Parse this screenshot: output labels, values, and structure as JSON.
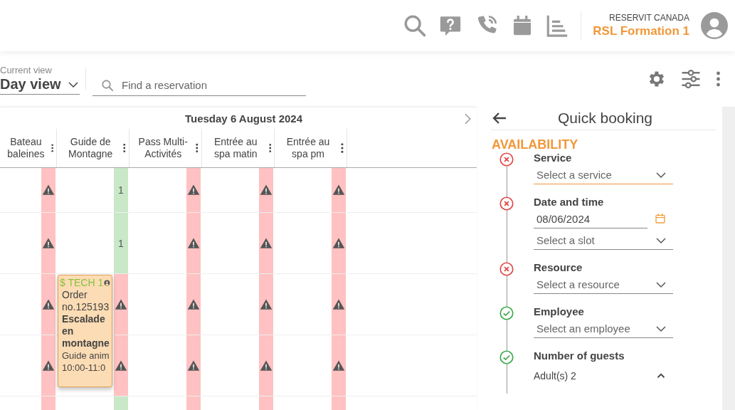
{
  "header": {
    "company": "RESERVIT CANADA",
    "account": "RSL Formation 1"
  },
  "toolbar": {
    "view_label": "Current view",
    "view": "Day view",
    "search": {
      "placeholder": "Find a reservation"
    }
  },
  "calendar": {
    "date": "Tuesday 6 August 2024",
    "columns": [
      {
        "name": "Bateau baleines",
        "slots": [
          {
            "kind": "full",
            "warning": true
          },
          {
            "kind": "full",
            "warning": true
          },
          {
            "kind": "full",
            "warning": true
          },
          {
            "kind": "full",
            "warning": true
          },
          {
            "kind": "full",
            "warning": false
          }
        ]
      },
      {
        "name": "Guide de Montagne",
        "slots": [
          {
            "kind": "available",
            "count": "1"
          },
          {
            "kind": "available",
            "count": "1"
          },
          {
            "kind": "full",
            "warning": true,
            "booking": {
              "tag": "$ TECH 1",
              "order": "Order no.125193",
              "service": "Escalade en montagne",
              "staff": "Guide anim",
              "time": "10:00-11:0"
            }
          },
          {
            "kind": "full",
            "warning": true
          },
          {
            "kind": "available"
          }
        ]
      },
      {
        "name": "Pass Multi-Activités",
        "slots": [
          {
            "kind": "full",
            "warning": true
          },
          {
            "kind": "full",
            "warning": true
          },
          {
            "kind": "full",
            "warning": true
          },
          {
            "kind": "full",
            "warning": true
          },
          {
            "kind": "full",
            "warning": false
          }
        ]
      },
      {
        "name": "Entrée au spa matin",
        "slots": [
          {
            "kind": "full",
            "warning": true
          },
          {
            "kind": "full",
            "warning": true
          },
          {
            "kind": "full",
            "warning": true
          },
          {
            "kind": "full",
            "warning": true
          },
          {
            "kind": "full",
            "warning": false
          }
        ]
      },
      {
        "name": "Entrée au spa pm",
        "slots": [
          {
            "kind": "full",
            "warning": true
          },
          {
            "kind": "full",
            "warning": true
          },
          {
            "kind": "full",
            "warning": true
          },
          {
            "kind": "full",
            "warning": true
          },
          {
            "kind": "full",
            "warning": false
          }
        ]
      }
    ]
  },
  "booking": {
    "title": "Quick booking",
    "section": "AVAILABILITY",
    "steps": [
      {
        "label": "Service",
        "complete": false,
        "fields": [
          {
            "kind": "select",
            "placeholder": "Select a service",
            "focused": true
          }
        ]
      },
      {
        "label": "Date and time",
        "complete": false,
        "fields": [
          {
            "kind": "date",
            "value": "08/06/2024"
          },
          {
            "kind": "select",
            "placeholder": "Select a slot",
            "focused": false
          }
        ]
      },
      {
        "label": "Resource",
        "complete": false,
        "fields": [
          {
            "kind": "select",
            "placeholder": "Select a resource",
            "focused": false
          }
        ]
      },
      {
        "label": "Employee",
        "complete": true,
        "fields": [
          {
            "kind": "select",
            "placeholder": "Select an employee",
            "focused": false
          }
        ]
      },
      {
        "label": "Number of guests",
        "complete": true,
        "fields": [
          {
            "kind": "counter",
            "label": "Adult(s)",
            "value": "2",
            "expanded": true
          }
        ]
      }
    ]
  }
}
